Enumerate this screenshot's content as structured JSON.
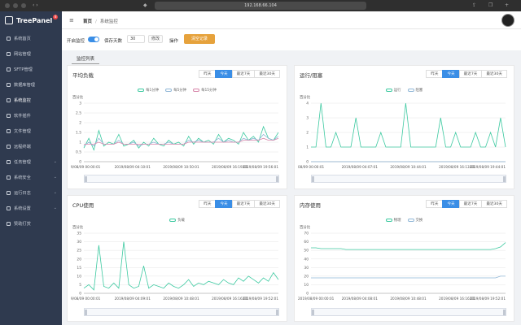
{
  "browser": {
    "url": "192.168.66.104"
  },
  "sidebar": {
    "logo": "TreePanel",
    "badge": "8",
    "items": [
      {
        "label": "系统首页"
      },
      {
        "label": "网站管理"
      },
      {
        "label": "SFTP管理"
      },
      {
        "label": "数据库管理"
      },
      {
        "label": "系统监控"
      },
      {
        "label": "软件插件"
      },
      {
        "label": "文件管理"
      },
      {
        "label": "远程终端"
      },
      {
        "label": "任务管理"
      },
      {
        "label": "系统安全"
      },
      {
        "label": "运行日志"
      },
      {
        "label": "系统设置"
      },
      {
        "label": "赞助打赏"
      }
    ],
    "active_index": 4
  },
  "header": {
    "crumb_home": "首页",
    "crumb_current": "系统监控"
  },
  "toolbar": {
    "monitor_label": "开启监控",
    "save_days_label": "保存天数",
    "days_value": "30",
    "modify_label": "修改",
    "action_label": "操作",
    "clear_label": "清空记录"
  },
  "section_tab": "监控列表",
  "ranges": [
    "昨天",
    "今天",
    "最近7天",
    "最近30天"
  ],
  "panels": {
    "load": {
      "title": "平均负载",
      "ylabel": "百分比",
      "legend": [
        "每1分钟",
        "每5分钟",
        "每15分钟"
      ]
    },
    "io": {
      "title": "运行/阻塞",
      "ylabel": "百分比",
      "legend": [
        "运行",
        "阻塞"
      ]
    },
    "cpu": {
      "title": "CPU使用",
      "ylabel": "百分比",
      "legend": [
        "负载"
      ]
    },
    "memory": {
      "title": "内存使用",
      "ylabel": "百分比",
      "legend": [
        "物理",
        "交换"
      ]
    }
  },
  "colors": {
    "accent": "#3a8ee6",
    "warn": "#e6a23c",
    "series1": "#3cc9a0",
    "series2": "#8fb6d6",
    "series3": "#d684a8",
    "sidebar": "#2f3a4f"
  },
  "chart_data": [
    {
      "type": "line",
      "title": "平均负载",
      "ylabel": "百分比",
      "ylim": [
        0,
        3
      ],
      "yticks": [
        "3",
        "2.5",
        "2",
        "1.5",
        "1",
        "0.5",
        "0"
      ],
      "xticks": [
        "9/08/09 00:00:01",
        "2019/08/09 04:10:01",
        "2019/08/09 10:50:01",
        "2019/08/09 16:19:01",
        "2019/08/09 19:56:01"
      ],
      "series": [
        {
          "name": "每1分钟",
          "values": [
            0.7,
            1.2,
            0.6,
            1.6,
            0.8,
            1.0,
            0.9,
            1.4,
            0.8,
            0.9,
            1.1,
            0.7,
            1.0,
            0.8,
            1.2,
            0.9,
            0.8,
            1.1,
            0.9,
            1.0,
            0.8,
            1.3,
            0.9,
            1.2,
            1.0,
            1.1,
            0.9,
            1.4,
            1.0,
            1.2,
            1.1,
            0.9,
            1.5,
            1.1,
            1.3,
            1.0,
            1.8,
            1.2,
            1.1,
            1.5
          ]
        },
        {
          "name": "每5分钟",
          "values": [
            0.8,
            1.0,
            0.8,
            1.2,
            0.9,
            0.9,
            0.9,
            1.1,
            0.9,
            0.9,
            1.0,
            0.8,
            0.9,
            0.9,
            1.0,
            0.9,
            0.9,
            1.0,
            0.9,
            0.9,
            0.9,
            1.1,
            1.0,
            1.1,
            1.0,
            1.0,
            1.0,
            1.2,
            1.0,
            1.1,
            1.0,
            1.0,
            1.2,
            1.1,
            1.2,
            1.1,
            1.4,
            1.2,
            1.1,
            1.3
          ]
        },
        {
          "name": "每15分钟",
          "values": [
            0.9,
            0.9,
            0.9,
            1.0,
            0.9,
            0.9,
            0.9,
            1.0,
            0.9,
            0.9,
            0.9,
            0.9,
            0.9,
            0.9,
            0.9,
            0.9,
            0.9,
            0.9,
            0.9,
            0.9,
            0.9,
            1.0,
            1.0,
            1.0,
            1.0,
            1.0,
            1.0,
            1.0,
            1.0,
            1.0,
            1.0,
            1.0,
            1.1,
            1.1,
            1.1,
            1.1,
            1.2,
            1.1,
            1.1,
            1.2
          ]
        }
      ]
    },
    {
      "type": "line",
      "title": "运行/阻塞",
      "ylabel": "百分比",
      "ylim": [
        0,
        4
      ],
      "yticks": [
        "4",
        "3",
        "2",
        "1",
        "0"
      ],
      "xticks": [
        "08/09 00:00:01",
        "2019/08/09 04:07:01",
        "2019/08/09 10:44:01",
        "2019/08/09 16:13:01",
        "2019/08/09 19:44:01"
      ],
      "series": [
        {
          "name": "运行",
          "values": [
            1,
            1,
            4,
            1,
            1,
            2,
            1,
            1,
            1,
            3,
            1,
            1,
            1,
            1,
            2,
            1,
            1,
            1,
            1,
            4,
            1,
            1,
            1,
            1,
            1,
            1,
            3,
            1,
            1,
            2,
            1,
            1,
            1,
            2,
            1,
            1,
            2,
            1,
            3,
            1
          ]
        },
        {
          "name": "阻塞",
          "values": [
            0,
            0,
            0,
            0,
            0,
            0,
            0,
            0,
            0,
            0,
            0,
            0,
            0,
            0,
            0,
            0,
            0,
            0,
            0,
            0,
            0,
            0,
            0,
            0,
            0,
            0,
            0,
            0,
            0,
            0,
            0,
            0,
            0,
            0,
            0,
            0,
            0,
            0,
            0,
            0
          ]
        }
      ]
    },
    {
      "type": "line",
      "title": "CPU使用",
      "ylabel": "百分比",
      "ylim": [
        0,
        35
      ],
      "yticks": [
        "35",
        "30",
        "25",
        "20",
        "15",
        "10",
        "5",
        "0"
      ],
      "xticks": [
        "9/08/09 00:00:01",
        "2019/08/09 04:09:01",
        "2019/08/09 10:48:01",
        "2019/08/09 16:16:01",
        "2019/08/09 19:52:01"
      ],
      "series": [
        {
          "name": "负载",
          "values": [
            3,
            5,
            2,
            28,
            4,
            3,
            6,
            3,
            30,
            5,
            3,
            4,
            16,
            3,
            5,
            4,
            3,
            6,
            4,
            3,
            5,
            8,
            4,
            6,
            5,
            7,
            6,
            5,
            8,
            6,
            5,
            9,
            7,
            10,
            8,
            6,
            9,
            7,
            12,
            8
          ]
        }
      ]
    },
    {
      "type": "line",
      "title": "内存使用",
      "ylabel": "百分比",
      "ylim": [
        0,
        70
      ],
      "yticks": [
        "70",
        "60",
        "50",
        "40",
        "30",
        "20",
        "10",
        "0"
      ],
      "xticks": [
        "2019/08/09 00:00:01",
        "2019/08/09 04:08:01",
        "2019/08/09 10:48:01",
        "2019/08/09 16:16:01",
        "2019/08/09 19:52:01"
      ],
      "series": [
        {
          "name": "物理",
          "values": [
            53,
            53,
            52,
            52,
            52,
            52,
            52,
            51,
            51,
            51,
            51,
            51,
            51,
            51,
            51,
            51,
            51,
            51,
            51,
            51,
            51,
            51,
            51,
            51,
            51,
            51,
            51,
            51,
            51,
            51,
            51,
            51,
            51,
            51,
            51,
            51,
            51,
            52,
            54,
            59
          ]
        },
        {
          "name": "交换",
          "values": [
            18,
            18,
            18,
            18,
            18,
            18,
            18,
            18,
            18,
            18,
            18,
            18,
            18,
            18,
            18,
            18,
            18,
            18,
            18,
            18,
            18,
            18,
            18,
            18,
            18,
            18,
            18,
            18,
            18,
            18,
            18,
            18,
            18,
            18,
            18,
            18,
            18,
            18,
            20,
            20
          ]
        }
      ]
    }
  ]
}
